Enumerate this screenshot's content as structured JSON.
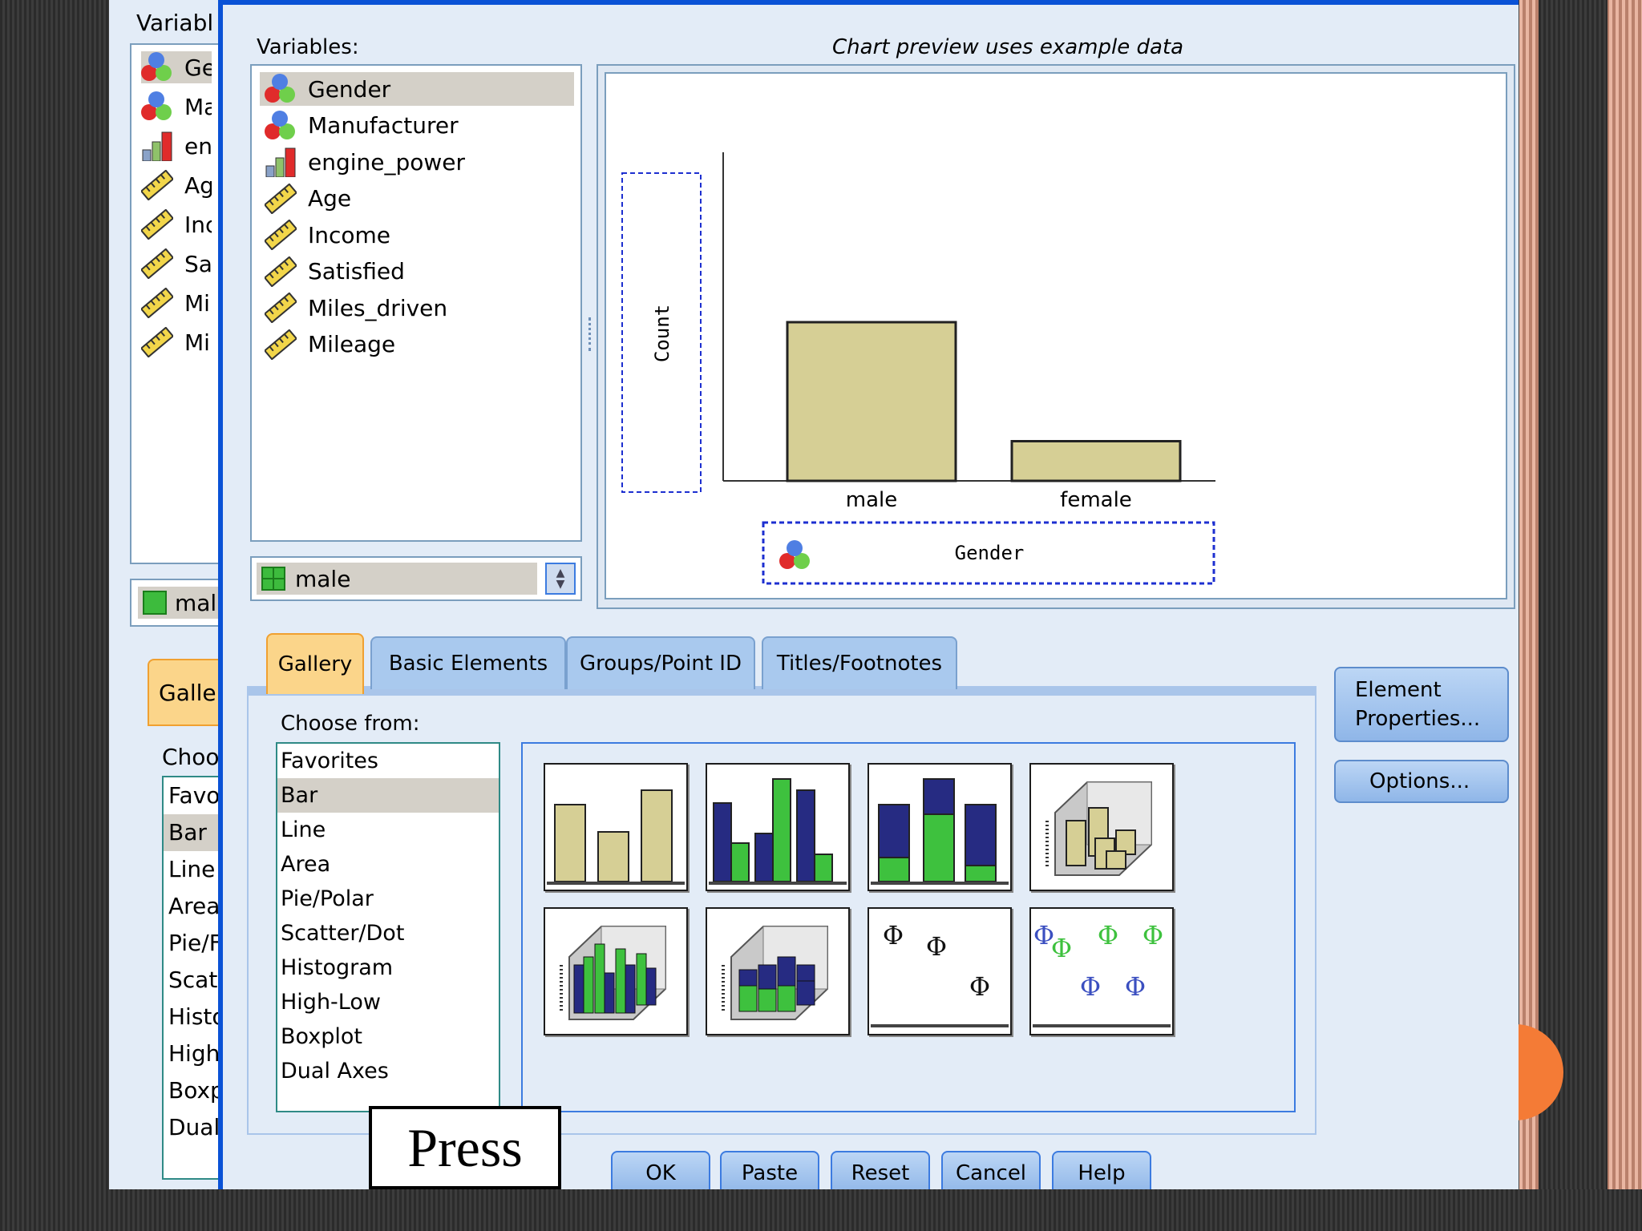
{
  "background_dialog": {
    "variables_label": "Variabl",
    "variables": [
      "Ge",
      "Ma",
      "en",
      "Ag",
      "Inc",
      "Sa",
      "Mi",
      "Mi"
    ],
    "value": "mal",
    "tab_label": "Galle",
    "choose_label": "Choo",
    "categories": [
      "Favo",
      "Bar",
      "Line",
      "Area",
      "Pie/F",
      "Scat",
      "Histo",
      "High",
      "Boxp",
      "Dual"
    ]
  },
  "dialog": {
    "variables_label": "Variables:",
    "preview_note": "Chart preview uses example data",
    "variables": [
      {
        "name": "Gender",
        "type": "nominal",
        "selected": true
      },
      {
        "name": "Manufacturer",
        "type": "nominal",
        "selected": false
      },
      {
        "name": "engine_power",
        "type": "ordinal",
        "selected": false
      },
      {
        "name": "Age",
        "type": "scale",
        "selected": false
      },
      {
        "name": "Income",
        "type": "scale",
        "selected": false
      },
      {
        "name": "Satisfied",
        "type": "scale",
        "selected": false
      },
      {
        "name": "Miles_driven",
        "type": "scale",
        "selected": false
      },
      {
        "name": "Mileage",
        "type": "scale",
        "selected": false
      }
    ],
    "value_dropdown": "male",
    "preview": {
      "y_label": "Count",
      "x_label": "Gender",
      "chart_data": {
        "type": "bar",
        "categories": [
          "male",
          "female"
        ],
        "values": [
          1.0,
          0.25
        ],
        "xlabel": "Gender",
        "ylabel": "Count",
        "color": "#d6cf95"
      }
    },
    "tabs": [
      "Gallery",
      "Basic Elements",
      "Groups/Point ID",
      "Titles/Footnotes"
    ],
    "active_tab": "Gallery",
    "choose_from_label": "Choose from:",
    "categories": [
      "Favorites",
      "Bar",
      "Line",
      "Area",
      "Pie/Polar",
      "Scatter/Dot",
      "Histogram",
      "High-Low",
      "Boxplot",
      "Dual Axes"
    ],
    "selected_category": "Bar",
    "gallery_items": [
      "simple-bar",
      "clustered-bar",
      "stacked-bar",
      "3d-bar",
      "3d-clustered-bar",
      "3d-stacked-bar",
      "simple-error-bar",
      "clustered-error-bar"
    ],
    "side_buttons": {
      "element_properties": "Element Properties...",
      "options": "Options..."
    },
    "buttons": {
      "ok": "OK",
      "paste": "Paste",
      "reset": "Reset",
      "cancel": "Cancel",
      "help": "Help"
    }
  },
  "callout": {
    "text": "Press"
  },
  "colors": {
    "accent": "#0a52d6",
    "tab_active": "#fbd58a",
    "bar_tan": "#d6cf95",
    "bar_navy": "#262b82",
    "bar_green": "#3ec13e"
  }
}
